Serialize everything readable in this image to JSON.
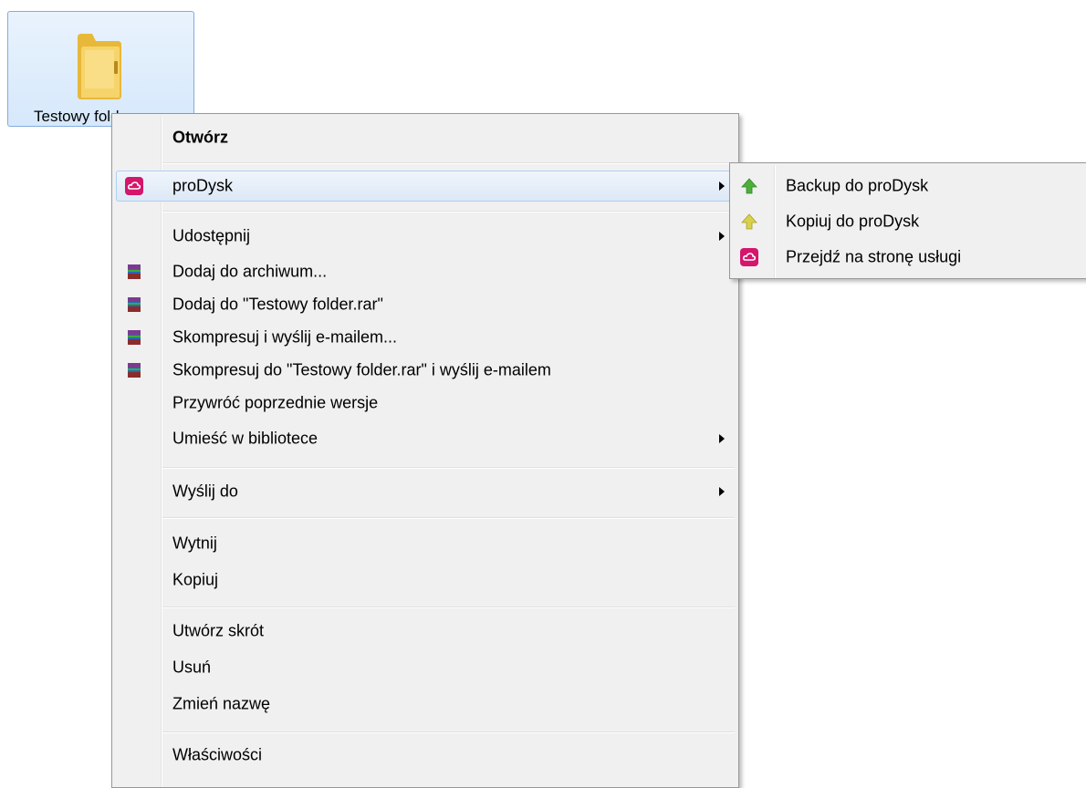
{
  "desktop": {
    "folder_label": "Testowy folder"
  },
  "menu": {
    "items": [
      {
        "label": "Otwórz"
      },
      {
        "label": "proDysk"
      },
      {
        "label": "Udostępnij"
      },
      {
        "label": "Dodaj do archiwum..."
      },
      {
        "label": "Dodaj do \"Testowy folder.rar\""
      },
      {
        "label": "Skompresuj i wyślij e-mailem..."
      },
      {
        "label": "Skompresuj do \"Testowy folder.rar\" i wyślij e-mailem"
      },
      {
        "label": "Przywróć poprzednie wersje"
      },
      {
        "label": "Umieść w bibliotece"
      },
      {
        "label": "Wyślij do"
      },
      {
        "label": "Wytnij"
      },
      {
        "label": "Kopiuj"
      },
      {
        "label": "Utwórz skrót"
      },
      {
        "label": "Usuń"
      },
      {
        "label": "Zmień nazwę"
      },
      {
        "label": "Właściwości"
      }
    ]
  },
  "submenu": {
    "items": [
      {
        "label": "Backup do proDysk"
      },
      {
        "label": "Kopiuj do proDysk"
      },
      {
        "label": "Przejdź na stronę usługi"
      }
    ]
  },
  "colors": {
    "prodysk_brand": "#d4166c",
    "backup_arrow": "#4caf3a",
    "copy_arrow": "#c8c23a"
  }
}
